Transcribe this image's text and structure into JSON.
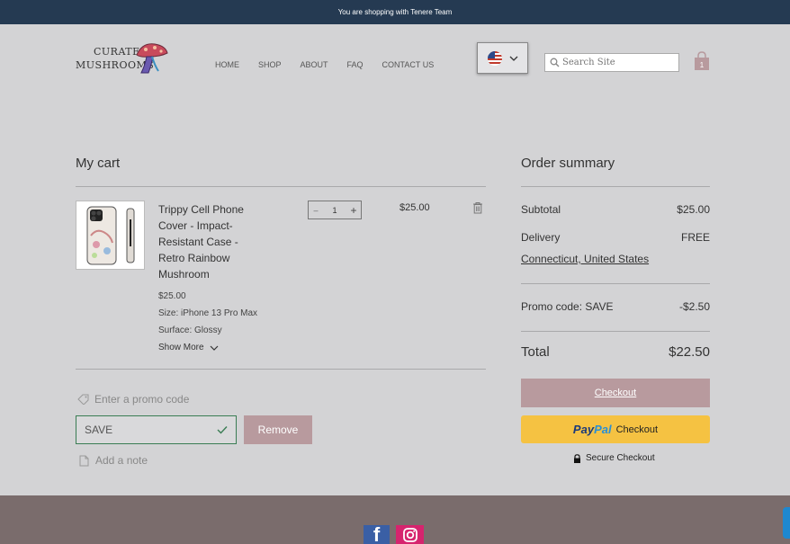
{
  "topbar": {
    "text": "You are shopping with Tenere Team"
  },
  "header": {
    "logo": {
      "line1": "CURATED",
      "line2": "MUSHROOMS"
    },
    "nav": [
      "HOME",
      "SHOP",
      "ABOUT",
      "FAQ",
      "CONTACT US"
    ],
    "search_placeholder": "Search Site",
    "cart_count": "1"
  },
  "cart": {
    "title": "My cart",
    "item": {
      "name": "Trippy Cell Phone Cover - Impact-Resistant Case - Retro Rainbow Mushroom",
      "unit_price": "$25.00",
      "size": "Size: iPhone 13 Pro Max",
      "surface": "Surface: Glossy",
      "show_more": "Show More",
      "quantity": "1",
      "price": "$25.00"
    },
    "promo_link": "Enter a promo code",
    "promo_value": "SAVE",
    "remove_label": "Remove",
    "note_link": "Add a note"
  },
  "summary": {
    "title": "Order summary",
    "subtotal_label": "Subtotal",
    "subtotal_value": "$25.00",
    "delivery_label": "Delivery",
    "delivery_value": "FREE",
    "ship_location": "Connecticut, United States",
    "promo_label": "Promo code: SAVE",
    "promo_value": "-$2.50",
    "total_label": "Total",
    "total_value": "$22.50",
    "checkout_label": "Checkout",
    "paypal_pay": "Pay",
    "paypal_pal": "Pal",
    "paypal_checkout": "Checkout",
    "secure_label": "Secure Checkout"
  },
  "colors": {
    "topbar": "#253a52",
    "accent_button": "#b89a9e",
    "paypal": "#f5c242",
    "footer": "#7a6c6c"
  }
}
